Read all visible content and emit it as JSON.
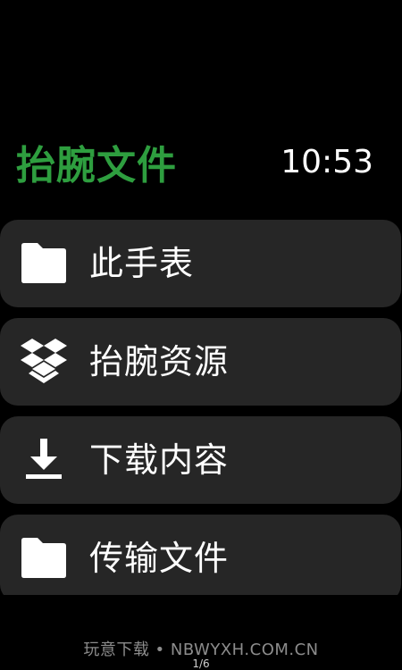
{
  "header": {
    "title": "抬腕文件",
    "time": "10:53"
  },
  "colors": {
    "accent": "#2e9e3f",
    "background": "#000000",
    "card": "#262626",
    "text": "#ffffff"
  },
  "menu": {
    "items": [
      {
        "label": "此手表",
        "icon": "folder-icon"
      },
      {
        "label": "抬腕资源",
        "icon": "dropbox-icon"
      },
      {
        "label": "下载内容",
        "icon": "download-icon"
      },
      {
        "label": "传输文件",
        "icon": "folder-icon"
      }
    ]
  },
  "footer": {
    "watermark": "玩意下载 • NBWYXH.COM.CN",
    "page_indicator": "1/6"
  }
}
